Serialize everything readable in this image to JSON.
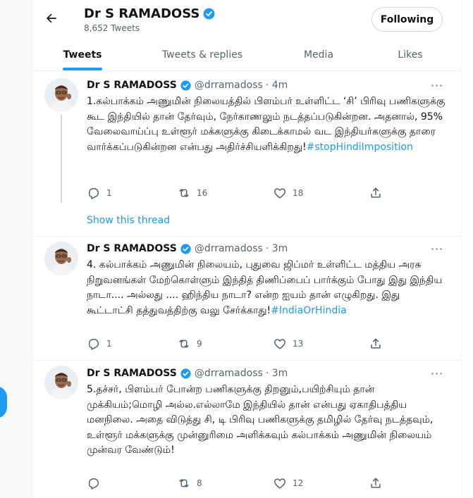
{
  "header": {
    "name": "Dr S RAMADOSS",
    "tweet_count": "8,652 Tweets",
    "follow_label": "Following"
  },
  "tabs": [
    "Tweets",
    "Tweets & replies",
    "Media",
    "Likes"
  ],
  "tweets": [
    {
      "name": "Dr S RAMADOSS",
      "handle": "@drramadoss",
      "time": "· 4m",
      "text": "1.கல்பாக்கம் அணுமின் நிலையத்தில் பிளம்பர் உள்ளிட்ட ‘சி’ பிரிவு பணிகளுக்கு கூட இந்தியில்  தான் தேர்வும், நேர்காணலும் நடத்தப்படுகின்றன. அதனால், 95% வேலைவாய்ப்பு உள்ளூர் மக்களுக்கு கிடைக்காமல் வட இந்தியர்களுக்கு தாரை வார்க்கப்படுகின்றன என்பது அதிர்ச்சியளிக்கிறது!",
      "hashtag": "#stopHindiImposition",
      "replies": "1",
      "retweets": "16",
      "likes": "18"
    },
    {
      "name": "Dr S RAMADOSS",
      "handle": "@drramadoss",
      "time": "· 3m",
      "text": "4. கல்பாக்கம் அணுமின் நிலையம், புதுவை ஜிப்மர் உள்ளிட்ட மத்திய அரசு நிறுவனங்கள் மேற்கொள்ளும் இந்தித் திணிப்பைப் பார்க்கும் போது இது இந்திய நாடா.... அல்லது .... ஹிந்திய நாடா? என்ற ஐயம் தான் எழுகிறது. இது கூட்டாட்சி தத்துவத்திற்கு  வலு சேர்க்காது!",
      "hashtag": "#IndiaOrHindia",
      "replies": "1",
      "retweets": "9",
      "likes": "13"
    },
    {
      "name": "Dr S RAMADOSS",
      "handle": "@drramadoss",
      "time": "· 3m",
      "text": "5.தச்சர், பிளம்பர் போன்ற பணிகளுக்கு திறனும்,பயிற்சியும் தான் முக்கியம்;மொழி அல்ல.எல்லாமே இந்தியில் தான் என்பது ஏகாதிபத்திய மனநிலை. அதை விடுத்து  சி,  டி பிரிவு பணிகளுக்கு தமிழில் தேர்வு நடத்தவும், உள்ளூர் மக்களுக்கு முன்னுரிமை அளிக்கவும் கல்பாக்கம் அணுமின் நிலையம் முன்வர வேண்டும்!",
      "hashtag": "",
      "replies": "",
      "retweets": "8",
      "likes": "12"
    }
  ],
  "show_thread_label": "Show this thread",
  "colors": {
    "accent": "#1d9bf0",
    "muted": "#536471",
    "text": "#0f1419"
  },
  "icons": [
    "back-arrow-icon",
    "verified-badge-icon",
    "reply-icon",
    "retweet-icon",
    "like-icon",
    "share-icon",
    "more-icon"
  ]
}
